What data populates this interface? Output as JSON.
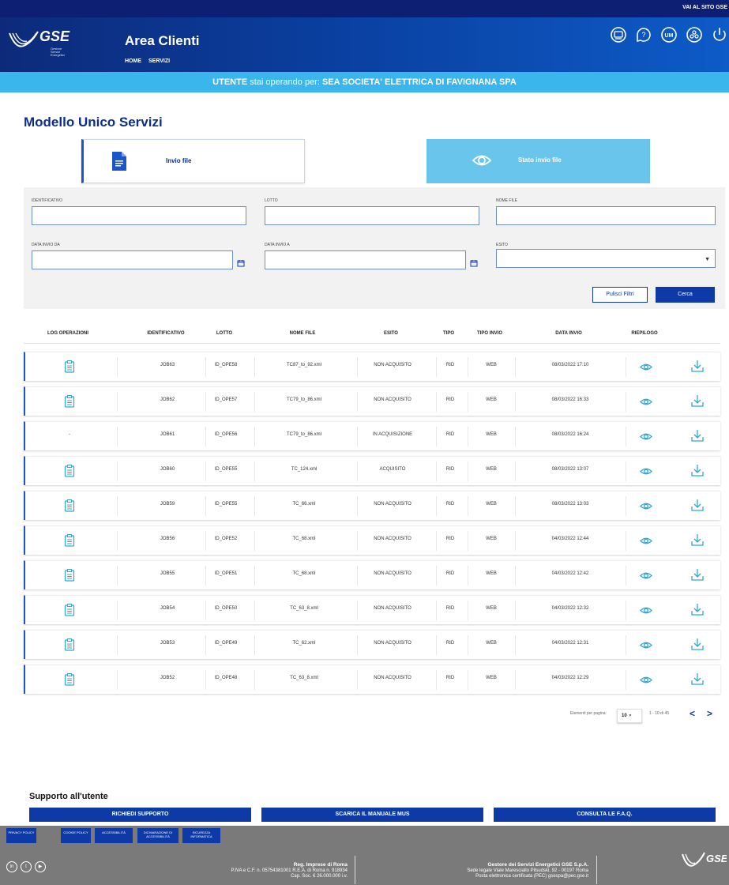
{
  "topbar": {
    "link": "VAI AL SITO GSE"
  },
  "header": {
    "logo_text": "GSE",
    "logo_sub": "Gestore Servizi Energetici",
    "title": "Area Clienti",
    "nav": [
      "HOME",
      "SERVIZI"
    ],
    "icons": [
      "chat-icon",
      "help-icon",
      "um-icon",
      "users-icon",
      "power-icon"
    ],
    "um_label": "UM"
  },
  "user_bar": {
    "label": "UTENTE",
    "text": "stai operando per:",
    "company": "SEA SOCIETA' ELETTRICA DI FAVIGNANA SPA"
  },
  "page": {
    "title": "Modello Unico Servizi"
  },
  "cards": [
    {
      "label": "Invio file",
      "icon": "file-icon"
    },
    {
      "label": "Stato invio file",
      "icon": "eye-icon"
    }
  ],
  "filters": {
    "identificativo_label": "IDENTIFICATIVO",
    "lotto_label": "LOTTO",
    "nome_file_label": "NOME FILE",
    "data_da_label": "DATA INVIO DA",
    "data_a_label": "DATA INVIO A",
    "esito_label": "ESITO",
    "clear_button": "Pulisci Filtri",
    "search_button": "Cerca"
  },
  "table": {
    "headers": [
      "LOG OPERAZIONI",
      "IDENTIFICATIVO",
      "LOTTO",
      "NOME FILE",
      "ESITO",
      "TIPO",
      "TIPO INVIO",
      "DATA INVIO",
      "RIEPILOGO"
    ],
    "rows": [
      {
        "log": "icon",
        "id": "JOB63",
        "lotto": "ID_OPE58",
        "file": "TC87_to_92.xml",
        "esito": "NON ACQUISITO",
        "tipo": "RID",
        "invio": "WEB",
        "data": "08/03/2022 17:10"
      },
      {
        "log": "icon",
        "id": "JOB62",
        "lotto": "ID_OPE57",
        "file": "TC79_to_86.xml",
        "esito": "NON ACQUISITO",
        "tipo": "RID",
        "invio": "WEB",
        "data": "08/03/2022 16:33"
      },
      {
        "log": "-",
        "id": "JOB61",
        "lotto": "ID_OPE56",
        "file": "TC79_to_86.xml",
        "esito": "IN ACQUISIZIONE",
        "tipo": "RID",
        "invio": "WEB",
        "data": "08/03/2022 16:24"
      },
      {
        "log": "icon",
        "id": "JOB60",
        "lotto": "ID_OPE55",
        "file": "TC_124.xml",
        "esito": "ACQUISITO",
        "tipo": "RID",
        "invio": "WEB",
        "data": "08/03/2022 13:07"
      },
      {
        "log": "icon",
        "id": "JOB59",
        "lotto": "ID_OPE55",
        "file": "TC_66.xml",
        "esito": "NON ACQUISITO",
        "tipo": "RID",
        "invio": "WEB",
        "data": "08/03/2022 13:03"
      },
      {
        "log": "icon",
        "id": "JOB56",
        "lotto": "ID_OPE52",
        "file": "TC_68.xml",
        "esito": "NON ACQUISITO",
        "tipo": "RID",
        "invio": "WEB",
        "data": "04/03/2022 12:44"
      },
      {
        "log": "icon",
        "id": "JOB55",
        "lotto": "ID_OPE51",
        "file": "TC_68.xml",
        "esito": "NON ACQUISITO",
        "tipo": "RID",
        "invio": "WEB",
        "data": "04/03/2022 12:42"
      },
      {
        "log": "icon",
        "id": "JOB54",
        "lotto": "ID_OPE50",
        "file": "TC_63_8.xml",
        "esito": "NON ACQUISITO",
        "tipo": "RID",
        "invio": "WEB",
        "data": "04/03/2022 12:32"
      },
      {
        "log": "icon",
        "id": "JOB53",
        "lotto": "ID_OPE49",
        "file": "TC_62.xml",
        "esito": "NON ACQUISITO",
        "tipo": "RID",
        "invio": "WEB",
        "data": "04/03/2022 12:31"
      },
      {
        "log": "icon",
        "id": "JOB52",
        "lotto": "ID_OPE48",
        "file": "TC_63_8.xml",
        "esito": "NON ACQUISITO",
        "tipo": "RID",
        "invio": "WEB",
        "data": "04/03/2022 12:29"
      }
    ]
  },
  "pagination": {
    "per_page_label": "Elementi per pagina:",
    "per_page_value": "10",
    "range": "1 - 10 di 45",
    "prev": "<",
    "next": ">"
  },
  "support": {
    "title": "Supporto all'utente",
    "buttons": [
      "RICHIEDI SUPPORTO",
      "SCARICA IL MANUALE MUS",
      "CONSULTA LE F.A.Q."
    ]
  },
  "footer": {
    "links": [
      "PRIVACY POLICY",
      "COOKIE POLICY",
      "ACCESSIBILITÀ",
      "DICHIARAZIONE DI ACCESSIBILITÀ",
      "SICUREZZA INFORMATICA"
    ],
    "social": [
      "in",
      "t",
      "▶"
    ],
    "reg_title": "Reg. Imprese di Roma",
    "reg_line1": "P.IVA e C.F. n. 05754381001 R.E.A. di Roma n. 918934",
    "reg_line2": "Cap. Soc. € 26.000.000 i.v.",
    "gse_title": "Gestore dei Servizi Energetici GSE S.p.A.",
    "gse_line1": "Sede legale Viale Maresciallo Pilsudski, 92 - 00197 Roma",
    "gse_line2": "Posta elettronica certificata (PEC) gsespa@pec.gse.it",
    "logo_text": "GSE"
  },
  "colors": {
    "primary": "#0d3aa6",
    "accent": "#3ab6ec",
    "header": "#0a3f9f"
  }
}
